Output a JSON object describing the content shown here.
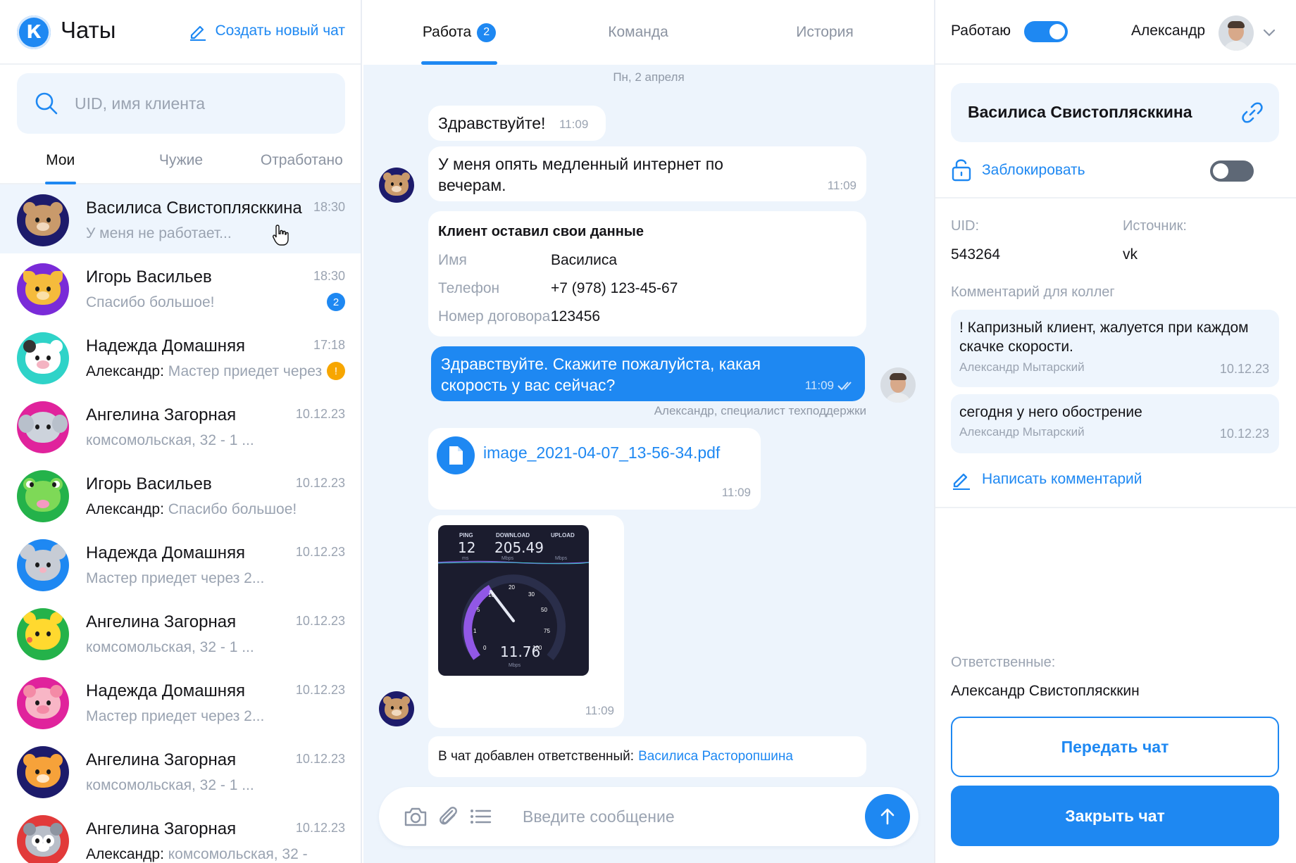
{
  "app": {
    "title": "Чаты",
    "logo_letter": "К",
    "new_chat_label": "Создать новый чат"
  },
  "search": {
    "placeholder": "UID, имя клиента"
  },
  "left_tabs": [
    {
      "label": "Мои",
      "active": true
    },
    {
      "label": "Чужие",
      "active": false
    },
    {
      "label": "Отработано",
      "active": false
    }
  ],
  "chats": [
    {
      "name": "Василиса Свистоплясккина",
      "time": "18:30",
      "author": "",
      "preview": "У меня не работает...",
      "badge": "",
      "avatar": "bear"
    },
    {
      "name": "Игорь Васильев",
      "time": "18:30",
      "author": "",
      "preview": "Спасибо большое!",
      "badge": "2",
      "avatar": "cat"
    },
    {
      "name": "Надежда Домашняя",
      "time": "17:18",
      "author": "Александр: ",
      "preview": "Мастер приедет через",
      "badge": "!",
      "avatar": "cow"
    },
    {
      "name": "Ангелина Загорная",
      "time": "10.12.23",
      "author": "",
      "preview": "комсомольская, 32 - 1 ...",
      "badge": "",
      "avatar": "elephant"
    },
    {
      "name": "Игорь Васильев",
      "time": "10.12.23",
      "author": "Александр: ",
      "preview": "Спасибо большое!",
      "badge": "",
      "avatar": "frog"
    },
    {
      "name": "Надежда Домашняя",
      "time": "10.12.23",
      "author": "",
      "preview": "Мастер приедет через 2...",
      "badge": "",
      "avatar": "mouse"
    },
    {
      "name": "Ангелина Загорная",
      "time": "10.12.23",
      "author": "",
      "preview": "комсомольская, 32 - 1 ...",
      "badge": "",
      "avatar": "pikachu"
    },
    {
      "name": "Надежда Домашняя",
      "time": "10.12.23",
      "author": "",
      "preview": "Мастер приедет через 2...",
      "badge": "",
      "avatar": "pig"
    },
    {
      "name": "Ангелина Загорная",
      "time": "10.12.23",
      "author": "",
      "preview": "комсомольская, 32 - 1 ...",
      "badge": "",
      "avatar": "tiger"
    },
    {
      "name": "Ангелина Загорная",
      "time": "10.12.23",
      "author": "Александр: ",
      "preview": "комсомольская, 32 -",
      "badge": "",
      "avatar": "raccoon"
    }
  ],
  "mid_tabs": [
    {
      "label": "Работа",
      "badge": "2",
      "active": true
    },
    {
      "label": "Команда",
      "badge": "",
      "active": false
    },
    {
      "label": "История",
      "badge": "",
      "active": false
    }
  ],
  "conversation": {
    "date": "Пн, 2 апреля",
    "m1": {
      "text": "Здравствуйте!",
      "time": "11:09"
    },
    "m2": {
      "line1": "У меня опять медленный интернет по",
      "line2": "вечерам.",
      "time": "11:09"
    },
    "card": {
      "title": "Клиент оставил свои данные",
      "rows": [
        {
          "k": "Имя",
          "v": "Василиса"
        },
        {
          "k": "Телефон",
          "v": "+7 (978) 123-45-67"
        },
        {
          "k": "Номер договора:",
          "v": "123456"
        }
      ]
    },
    "m3": {
      "line1": "Здравствуйте. Скажите пожалуйста, какая",
      "line2": "скорость у вас сейчас?",
      "time": "11:09",
      "caption": "Александр, специалист техподдержки"
    },
    "file": {
      "name": "image_2021-04-07_13-56-34.pdf",
      "time": "11:09"
    },
    "speedtest": {
      "ping_label": "PING",
      "ping": "12",
      "ping_unit": "ms",
      "download_label": "DOWNLOAD",
      "download": "205.49",
      "download_unit": "Mbps",
      "upload_label": "UPLOAD",
      "upload_unit": "Mbps",
      "current": "11.76",
      "current_unit": "Mbps",
      "scale": [
        "0",
        "1",
        "5",
        "10",
        "20",
        "30",
        "50",
        "75",
        "100"
      ],
      "time": "11:09"
    },
    "system": {
      "prefix": "В чат добавлен ответственный:",
      "link": "Василиса Расторопшина"
    }
  },
  "composer": {
    "placeholder": "Введите сообщение"
  },
  "right": {
    "status_label": "Работаю",
    "user_name": "Александр",
    "client_name": "Василиса Свистоплясккина",
    "block_label": "Заблокировать",
    "uid_label": "UID:",
    "uid": "543264",
    "source_label": "Источник:",
    "source": "vk",
    "comments_label": "Комментарий для коллег",
    "comments": [
      {
        "line1": "! Капризный клиент, жалуется при каждом",
        "line2": "скачке скорости.",
        "author": "Александр Мытарский",
        "date": "10.12.23"
      },
      {
        "line1": "сегодня у него обострение",
        "line2": "",
        "author": "Александр Мытарский",
        "date": "10.12.23"
      }
    ],
    "write_comment": "Написать комментарий",
    "responsible_label": "Ответственные:",
    "responsible": "Александр Свистоплясккин",
    "transfer_btn": "Передать чат",
    "close_btn": "Закрыть чат"
  },
  "colors": {
    "accent": "#1e88f2",
    "orange": "#f7a600",
    "chat_bg": "#edf4fc"
  }
}
